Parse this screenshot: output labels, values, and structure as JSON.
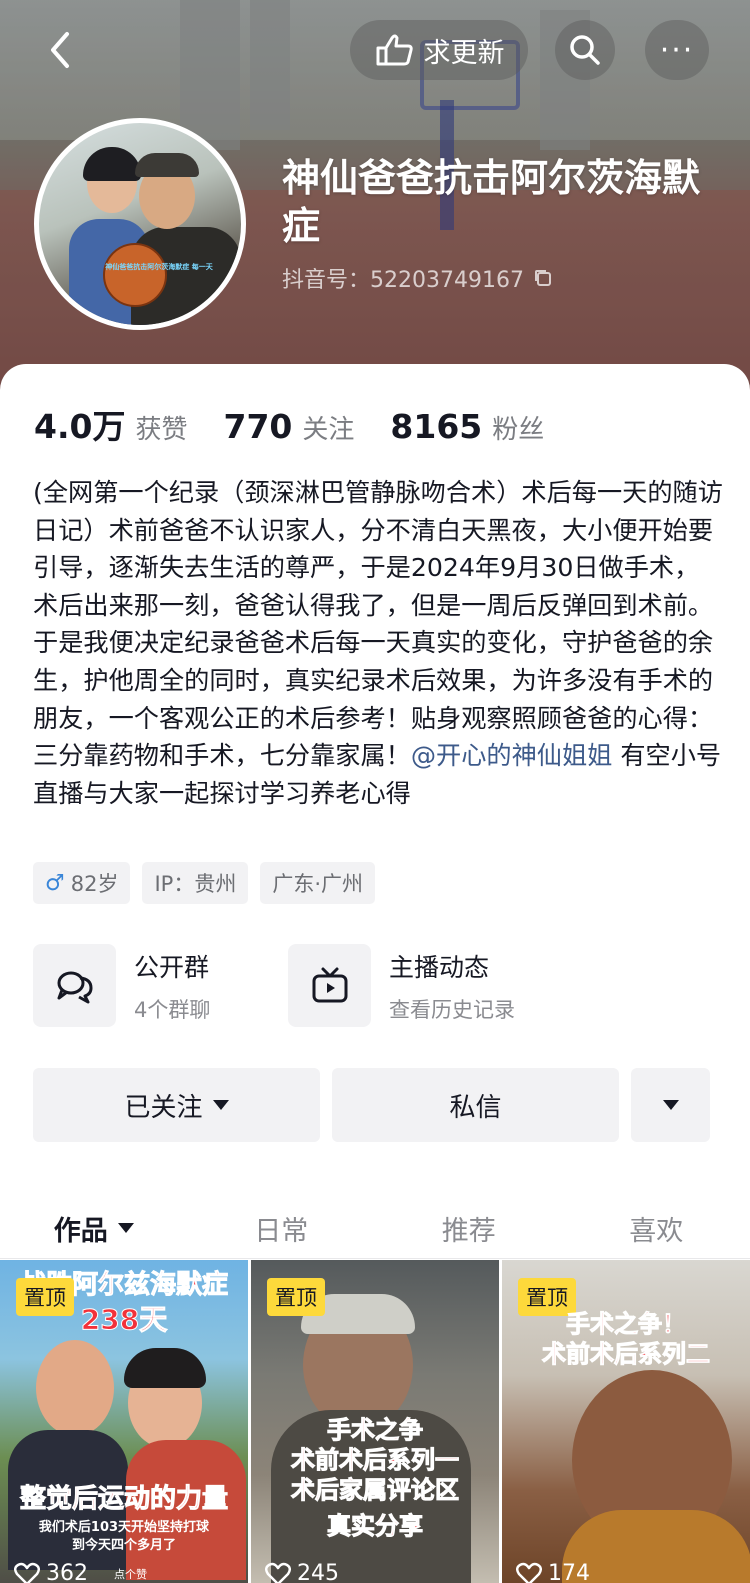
{
  "header": {
    "update_label": "求更新",
    "more_label": "···",
    "nickname": "神仙爸爸抗击阿尔茨海默症",
    "douyin_id": "抖音号：52203749167",
    "avatar_caption": "神仙爸爸抗击阿尔茨海默症 每一天"
  },
  "stats": [
    {
      "num": "4.0万",
      "label": "获赞"
    },
    {
      "num": "770",
      "label": "关注"
    },
    {
      "num": "8165",
      "label": "粉丝"
    }
  ],
  "bio": {
    "text": "(全网第一个纪录（颈深淋巴管静脉吻合术）术后每一天的随访日记）术前爸爸不认识家人，分不清白天黑夜，大小便开始要引导，逐渐失去生活的尊严，于是2024年9月30日做手术，术后出来那一刻，爸爸认得我了，但是一周后反弹回到术前。于是我便决定纪录爸爸术后每一天真实的变化，守护爸爸的余生，护他周全的同时，真实纪录术后效果，为许多没有手术的朋友，一个客观公正的术后参考！贴身观察照顾爸爸的心得：三分靠药物和手术，七分靠家属！",
    "mention": "@开心的神仙姐姐",
    "tail": " 有空小号直播与大家一起探讨学习养老心得"
  },
  "tags": {
    "age": "82岁",
    "ip": "IP：贵州",
    "location": "广东·广州"
  },
  "entries": [
    {
      "title": "公开群",
      "sub": "4个群聊",
      "icon": "chat-bubbles-icon"
    },
    {
      "title": "主播动态",
      "sub": "查看历史记录",
      "icon": "tv-icon"
    }
  ],
  "actions": {
    "follow": "已关注",
    "message": "私信"
  },
  "tabs": [
    "作品",
    "日常",
    "推荐",
    "喜欢"
  ],
  "videos": [
    {
      "pin": "置顶",
      "title_top": "战胜阿尔兹海默症",
      "title_sub": "238天",
      "caption": "整觉后运动的力量",
      "caption2": "我们术后103天开始坚持打球",
      "caption3": "到今天四个多月了",
      "likes": "362",
      "badge": "点个赞"
    },
    {
      "pin": "置顶",
      "caption": "手术之争",
      "caption2": "术前术后系列一",
      "caption3": "术后家属评论区",
      "caption4": "真实分享",
      "likes": "245"
    },
    {
      "pin": "置顶",
      "title_top": "手术之争！",
      "title_sub": "术前术后系列二",
      "likes": "174"
    }
  ],
  "colors": {
    "accent_mention": "#3d5a8a",
    "pin_yellow": "#fdd93b",
    "overlay_red": "#f2313a"
  }
}
